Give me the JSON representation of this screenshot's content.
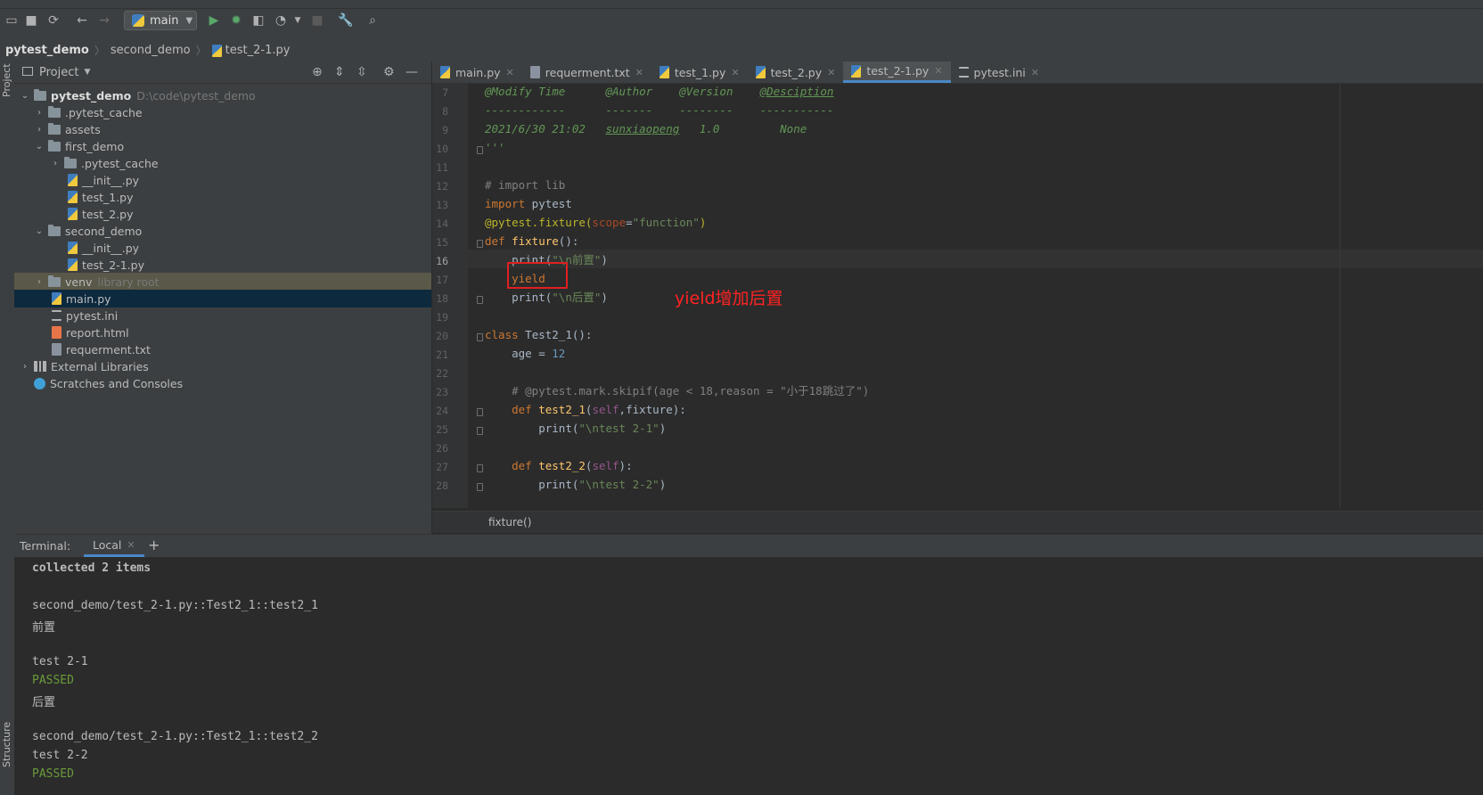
{
  "toolbar": {
    "run_config": "main"
  },
  "breadcrumb": [
    "pytest_demo",
    "second_demo",
    "test_2-1.py"
  ],
  "left_strip": {
    "project_label": "Project",
    "structure_label": "Structure"
  },
  "project_panel": {
    "title": "Project",
    "tree": [
      {
        "label": "pytest_demo",
        "hint": "D:\\code\\pytest_demo"
      },
      {
        "label": ".pytest_cache"
      },
      {
        "label": "assets"
      },
      {
        "label": "first_demo"
      },
      {
        "label": ".pytest_cache"
      },
      {
        "label": "__init__.py"
      },
      {
        "label": "test_1.py"
      },
      {
        "label": "test_2.py"
      },
      {
        "label": "second_demo"
      },
      {
        "label": "__init__.py"
      },
      {
        "label": "test_2-1.py"
      },
      {
        "label": "venv",
        "hint": "library root"
      },
      {
        "label": "main.py"
      },
      {
        "label": "pytest.ini"
      },
      {
        "label": "report.html"
      },
      {
        "label": "requerment.txt"
      },
      {
        "label": "External Libraries"
      },
      {
        "label": "Scratches and Consoles"
      }
    ]
  },
  "editor": {
    "tabs": [
      {
        "label": "main.py"
      },
      {
        "label": "requerment.txt"
      },
      {
        "label": "test_1.py"
      },
      {
        "label": "test_2.py"
      },
      {
        "label": "test_2-1.py"
      },
      {
        "label": "pytest.ini"
      }
    ],
    "line_numbers": [
      "7",
      "8",
      "9",
      "10",
      "11",
      "12",
      "13",
      "14",
      "15",
      "16",
      "17",
      "18",
      "19",
      "20",
      "21",
      "22",
      "23",
      "24",
      "25",
      "26",
      "27",
      "28"
    ],
    "code": {
      "l7a": "@Modify Time",
      "l7b": "@Author",
      "l7c": "@Version",
      "l7d": "@Desciption",
      "l8a": "------------",
      "l8b": "-------",
      "l8c": "--------",
      "l8d": "-----------",
      "l9a": "2021/6/30 21:02",
      "l9b": "sunxiaopeng",
      "l9c": "1.0",
      "l9d": "None",
      "l10": "'''",
      "l12": "# import lib",
      "l13a": "import",
      "l13b": " pytest",
      "l14a": "@pytest.fixture(",
      "l14b": "scope",
      "l14c": "=",
      "l14d": "\"function\"",
      "l14e": ")",
      "l15a": "def",
      "l15b": "fixture",
      "l15c": "():",
      "l16a": "print(",
      "l16b": "\"\\n前置\"",
      "l16c": ")",
      "l17": "yield",
      "l18a": "print(",
      "l18b": "\"\\n后置\"",
      "l18c": ")",
      "l20a": "class",
      "l20b": " Test2_1():",
      "l21a": "age = ",
      "l21b": "12",
      "l23": "# @pytest.mark.skipif(age < 18,reason = \"小于18跳过了\")",
      "l24a": "def",
      "l24b": "test2_1",
      "l24c": "(",
      "l24d": "self",
      "l24e": ",fixture):",
      "l25a": "print(",
      "l25b": "\"\\ntest 2-1\"",
      "l25c": ")",
      "l27a": "def",
      "l27b": "test2_2",
      "l27c": "(",
      "l27d": "self",
      "l27e": "):",
      "l28a": "print(",
      "l28b": "\"\\ntest 2-2\"",
      "l28c": ")"
    },
    "annotation": "yield增加后置",
    "status_breadcrumb": "fixture()"
  },
  "terminal": {
    "title": "Terminal:",
    "tab": "Local",
    "lines": [
      "collected 2 items",
      "",
      "second_demo/test_2-1.py::Test2_1::test2_1",
      "前置",
      "",
      "test 2-1",
      "PASSED",
      "后置",
      "",
      "second_demo/test_2-1.py::Test2_1::test2_2",
      "test 2-2",
      "PASSED"
    ]
  },
  "colors": {
    "pass": "#6a9a3a",
    "annotation": "#ff2222",
    "selection": "#0d293e",
    "library_root": "#5a5848"
  }
}
